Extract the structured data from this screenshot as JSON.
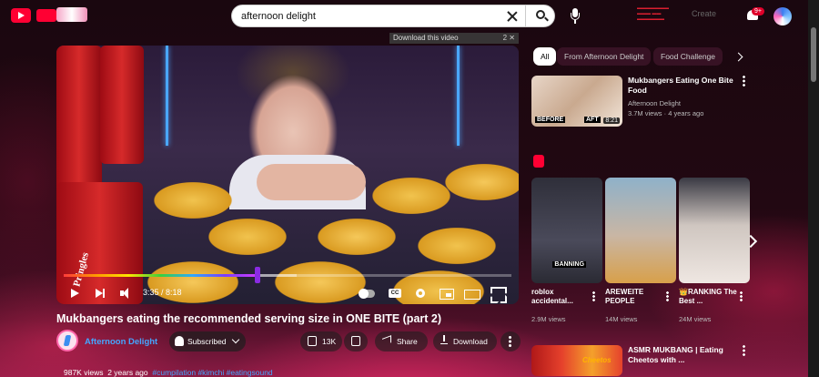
{
  "search": {
    "value": "afternoon delight"
  },
  "header": {
    "create_label": "Create",
    "notif_count": "9+"
  },
  "player": {
    "download_banner": "Download this video",
    "current_time": "3:35",
    "duration": "8:18",
    "time_display": "3:35 / 8:18",
    "progress_fraction": 0.432,
    "buffer_fraction": 0.52,
    "can_label": "Pringles"
  },
  "video": {
    "title": "Mukbangers eating the recommended serving size in ONE BITE (part 2)",
    "channel": "Afternoon Delight",
    "subscribe_label": "Subscribed",
    "likes": "13K",
    "share_label": "Share",
    "download_label": "Download",
    "views": "987K views",
    "age": "2 years ago",
    "tags": "#cumpilation #kimchi #eatingsound"
  },
  "chips": [
    {
      "label": "All",
      "active": true
    },
    {
      "label": "From Afternoon Delight",
      "active": false
    },
    {
      "label": "Food Challenge",
      "active": false
    }
  ],
  "related": [
    {
      "title": "Mukbangers Eating One Bite Food",
      "channel": "Afternoon Delight",
      "views": "3.7M views",
      "age": "4 years ago",
      "thumb_labels": [
        "BEFORE",
        "AFT"
      ],
      "duration": "8:21"
    },
    {
      "title": "ASMR MUKBANG | Eating Cheetos with ...",
      "channel": "",
      "views": "",
      "thumb_logo": "Cheetos"
    }
  ],
  "shorts": [
    {
      "title": "roblox accidental...",
      "views": "2.9M views",
      "caption": "BANNING"
    },
    {
      "title": "AREWEITE PEOPLE",
      "views": "14M views",
      "caption": ""
    },
    {
      "title": "👑RANKING The Best ...",
      "views": "24M views",
      "caption": ""
    }
  ],
  "colors": {
    "accent": "#ff0033",
    "link": "#45a6ff",
    "progress_scrubber": "#8a2be2"
  },
  "icons": [
    "youtube-logo-icon",
    "search-icon",
    "clear-icon",
    "mic-icon",
    "bell-icon",
    "avatar",
    "play-icon",
    "next-icon",
    "volume-icon",
    "cc-icon",
    "gear-icon",
    "miniplayer-icon",
    "theater-icon",
    "fullscreen-icon",
    "thumb-up-icon",
    "thumb-down-icon",
    "share-icon",
    "download-icon",
    "more-icon"
  ]
}
